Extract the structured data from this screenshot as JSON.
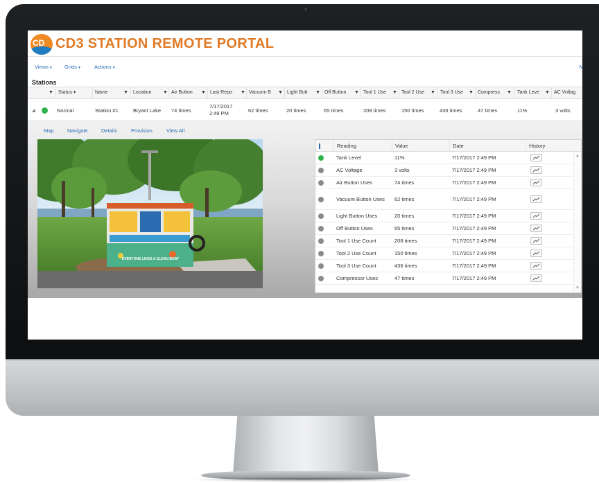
{
  "app": {
    "logo_text": "CD",
    "title": "CD3 STATION REMOTE PORTAL"
  },
  "menu": {
    "views": "Views",
    "grids": "Grids",
    "actions": "Actions",
    "right_item": "M"
  },
  "stations": {
    "section_title": "Stations",
    "columns": [
      "Status",
      "Name",
      "Location",
      "Air Button",
      "Last Repo",
      "Vacuum B",
      "Light Butt",
      "Off Button",
      "Tool 1 Use",
      "Tool 2 Use",
      "Tool 3 Use",
      "Compress",
      "Tank Leve",
      "AC Voltag"
    ],
    "row": {
      "status": "Normal",
      "name": "Station #1",
      "location": "Bryant Lake",
      "air_button": "74 times",
      "last_report_date": "7/17/2017",
      "last_report_time": "2:49 PM",
      "vacuum": "62 times",
      "light": "20 times",
      "off": "65 times",
      "tool1": "208 times",
      "tool2": "150 times",
      "tool3": "436 times",
      "compressor": "47 times",
      "tank": "11%",
      "ac_voltage": "3 volts"
    }
  },
  "detail_tabs": [
    "Map",
    "Navigate",
    "Details",
    "Provision",
    "View All"
  ],
  "readings": {
    "columns": [
      "Reading",
      "Value",
      "Date",
      "History"
    ],
    "rows": [
      {
        "status": "green",
        "reading": "Tank Level",
        "value": "11%",
        "date": "7/17/2017 2:49 PM"
      },
      {
        "status": "grey",
        "reading": "AC Voltage",
        "value": "3 volts",
        "date": "7/17/2017 2:49 PM"
      },
      {
        "status": "grey",
        "reading": "Air Button Uses",
        "value": "74 times",
        "date": "7/17/2017 2:49 PM"
      },
      {
        "status": "grey",
        "reading": "Vacuum Button Uses",
        "value": "62 times",
        "date": "7/17/2017 2:49 PM"
      },
      {
        "status": "grey",
        "reading": "Light Button Uses",
        "value": "20 times",
        "date": "7/17/2017 2:49 PM"
      },
      {
        "status": "grey",
        "reading": "Off Button Uses",
        "value": "65 times",
        "date": "7/17/2017 2:49 PM"
      },
      {
        "status": "grey",
        "reading": "Tool 1 Use Count",
        "value": "208 times",
        "date": "7/17/2017 2:49 PM"
      },
      {
        "status": "grey",
        "reading": "Tool 2 Use Count",
        "value": "150 times",
        "date": "7/17/2017 2:49 PM"
      },
      {
        "status": "grey",
        "reading": "Tool 3 Use Count",
        "value": "436 times",
        "date": "7/17/2017 2:49 PM"
      },
      {
        "status": "grey",
        "reading": "Compressor Uses",
        "value": "47 times",
        "date": "7/17/2017 2:49 PM"
      }
    ]
  },
  "photo": {
    "banner_text": "EVERYONE LIKES A CLEAN BOAT"
  },
  "colors": {
    "brand_orange": "#e07a26",
    "link_blue": "#2a6db5",
    "status_green": "#2fb24a",
    "status_grey": "#8a8a8a"
  },
  "icons": {
    "filter": "funnel-icon",
    "expand": "triangle-right-icon",
    "history": "line-chart-icon"
  }
}
